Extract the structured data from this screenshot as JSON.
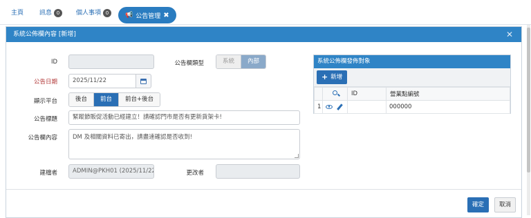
{
  "nav": {
    "home": "主頁",
    "messages": "訊息",
    "messages_count": "0",
    "personal": "個人事項",
    "personal_count": "0",
    "active_tab": "公告管理"
  },
  "modal": {
    "title": "系統公佈欄內容 [新增]",
    "labels": {
      "id": "ID",
      "type": "公告欄類型",
      "date": "公告日期",
      "platform": "顯示平台",
      "headline": "公告標題",
      "content": "公告欄內容",
      "creator": "建檔者",
      "modifier": "更改者"
    },
    "values": {
      "id": "",
      "date": "2025/11/22",
      "headline": "緊蹤節販促活動已經建立！請確認門市是否有更新貨架卡!",
      "content": "DM 及相關資料已寄出，請盡速確認是否收到!",
      "creator": "ADMIN@PKH01 (2025/11/22",
      "modifier": ""
    },
    "type_options": [
      "系統",
      "內部"
    ],
    "type_selected": "內部",
    "platform_options": [
      "後台",
      "前台",
      "前台+後台"
    ],
    "platform_selected": "前台"
  },
  "panel": {
    "title": "系統公佈欄發佈對象",
    "add_label": "新增",
    "columns": [
      "",
      "",
      "ID",
      "營業點編號"
    ],
    "rows": [
      {
        "index": "1",
        "id": "",
        "store_code": "000000"
      }
    ]
  },
  "footer": {
    "ok_label": "確定",
    "cancel_label": "取消"
  },
  "colors": {
    "primary": "#2a6fb5",
    "header": "#2f84c6",
    "required": "#b23a3a"
  }
}
